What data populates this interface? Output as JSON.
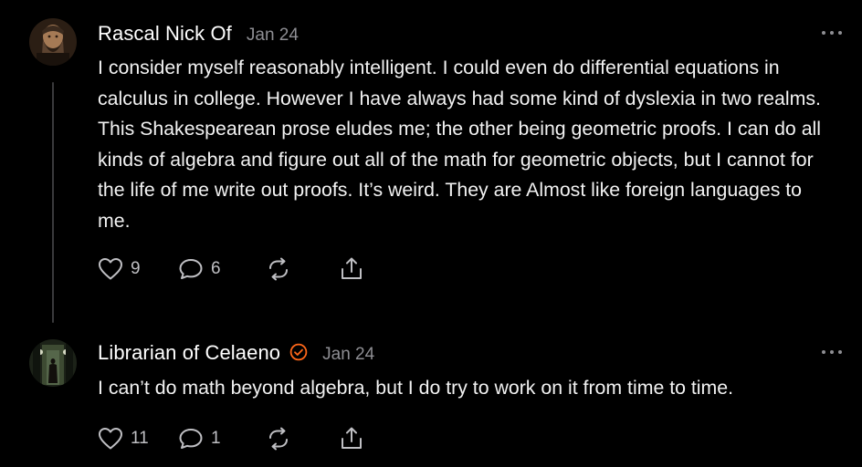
{
  "comments": [
    {
      "author": "Rascal Nick Of",
      "date": "Jan 24",
      "verified": false,
      "text": "I consider myself reasonably intelligent. I could even do differential equations in calculus in college. However I have always had some kind of dyslexia in two realms. This Shakespearean prose eludes me; the other being geometric proofs. I can do all kinds of algebra and figure out all of the math for geometric objects, but I cannot for the life of me write out proofs. It’s weird. They are Almost like foreign languages to me.",
      "likes": "9",
      "replies": "6",
      "avatar": "portrait-avatar"
    },
    {
      "author": "Librarian of Celaeno",
      "date": "Jan 24",
      "verified": true,
      "text": "I can’t do math beyond algebra, but I do try to work on it from time to time.",
      "likes": "11",
      "replies": "1",
      "avatar": "dark-corridor-avatar"
    }
  ],
  "icons": {
    "like": "heart-icon",
    "reply": "comment-bubble-icon",
    "restack": "restack-icon",
    "share": "share-icon",
    "more": "more-options-icon",
    "verified": "verified-check-icon"
  },
  "colors": {
    "background": "#000000",
    "text": "#f2f2f2",
    "muted": "#8e8e93",
    "verified": "#ff6719"
  }
}
